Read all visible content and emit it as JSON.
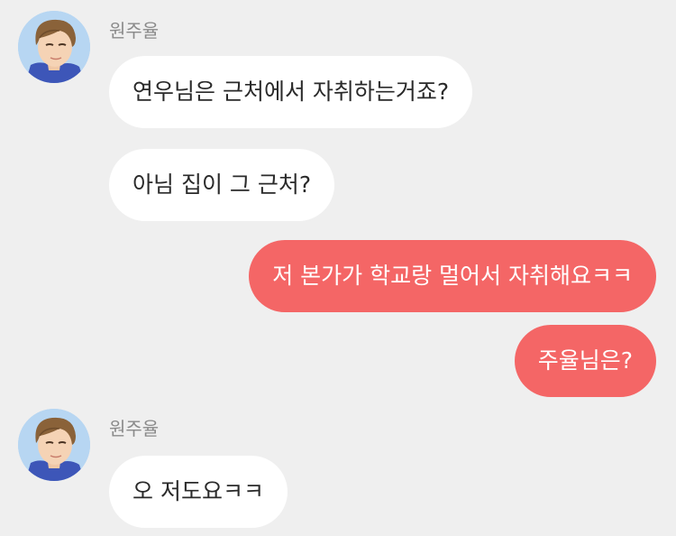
{
  "chat": {
    "colors": {
      "background": "#efefef",
      "incoming_bubble": "#ffffff",
      "outgoing_bubble": "#f46666",
      "sender_name": "#8a8a8a"
    },
    "messages": [
      {
        "sender": "원주율",
        "direction": "incoming",
        "avatar": "avatar-icon",
        "bubbles": [
          "연우님은 근처에서 자취하는거죠?",
          "아님 집이 그 근처?"
        ]
      },
      {
        "direction": "outgoing",
        "bubbles": [
          "저 본가가 학교랑 멀어서 자취해요ㅋㅋ",
          "주율님은?"
        ]
      },
      {
        "sender": "원주율",
        "direction": "incoming",
        "avatar": "avatar-icon",
        "bubbles": [
          "오 저도요ㅋㅋ"
        ]
      }
    ]
  }
}
